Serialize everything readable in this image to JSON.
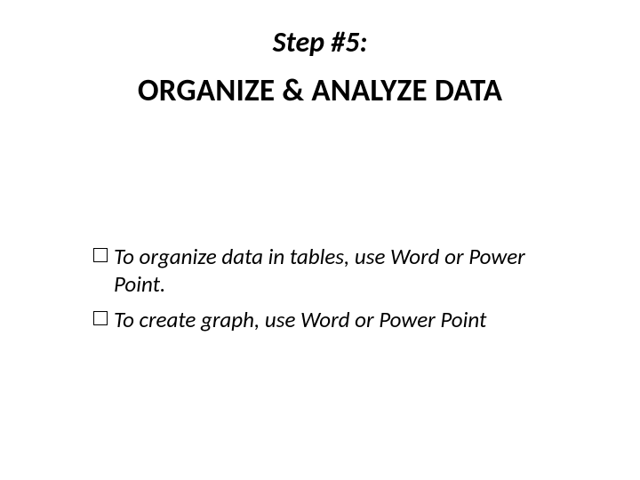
{
  "step_label": "Step #5:",
  "title": "ORGANIZE & ANALYZE DATA",
  "bullets": [
    "To organize data in tables, use Word or Power Point.",
    "To create graph, use Word or Power Point"
  ]
}
